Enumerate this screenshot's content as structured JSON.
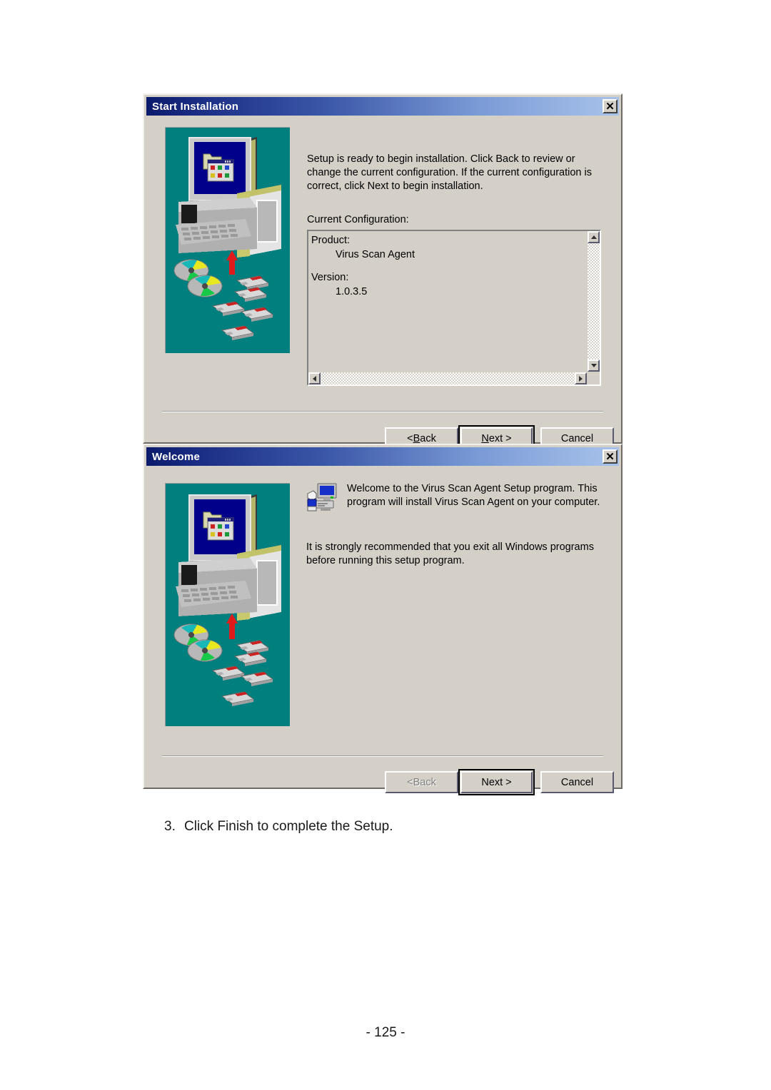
{
  "page": {
    "step_number": "3.",
    "step_text": "Click Finish to complete the Setup.",
    "page_number": "- 125 -"
  },
  "dialogs": [
    {
      "title": "Start Installation",
      "close_label": "✕",
      "body_paragraphs": [
        "Setup is ready to begin installation. Click Back to review or change the current configuration. If the current configuration is correct, click Next to begin installation."
      ],
      "config_label": "Current Configuration:",
      "config_list": [
        {
          "label": "Product:",
          "value": "Virus Scan Agent"
        },
        {
          "label": "Version:",
          "value": "1.0.3.5"
        }
      ],
      "buttons": {
        "back": {
          "pre": "< ",
          "accel": "B",
          "post": "ack",
          "disabled": false
        },
        "next": {
          "pre": "",
          "accel": "N",
          "post": "ext >",
          "default": true
        },
        "cancel": {
          "label": "Cancel"
        }
      }
    },
    {
      "title": "Welcome",
      "close_label": "✕",
      "body_paragraphs": [
        "Welcome to the Virus Scan Agent Setup program. This program will install Virus Scan Agent on your computer.",
        "It is strongly recommended that you exit all Windows programs before running this setup program."
      ],
      "buttons": {
        "back": {
          "pre": "< ",
          "accel": "",
          "post": "Back",
          "disabled": true
        },
        "next": {
          "pre": "",
          "accel": "",
          "post": "Next >",
          "default": true
        },
        "cancel": {
          "label": "Cancel"
        }
      }
    }
  ],
  "colors": {
    "dialog_face": "#d4d0c8",
    "title_gradient_start": "#0b1a6b",
    "title_gradient_end": "#a8c3ea",
    "illustration_bg": "#007f7f",
    "arrow_red": "#e01b1b",
    "monitor_screen": "#00008b"
  },
  "icons": {
    "setup_illustration": "setup-computer-media-illustration",
    "welcome_icon": "computer-hand-install-icon",
    "close": "close-icon",
    "scroll_up": "scroll-up-arrow-icon",
    "scroll_down": "scroll-down-arrow-icon",
    "scroll_left": "scroll-left-arrow-icon",
    "scroll_right": "scroll-right-arrow-icon"
  }
}
